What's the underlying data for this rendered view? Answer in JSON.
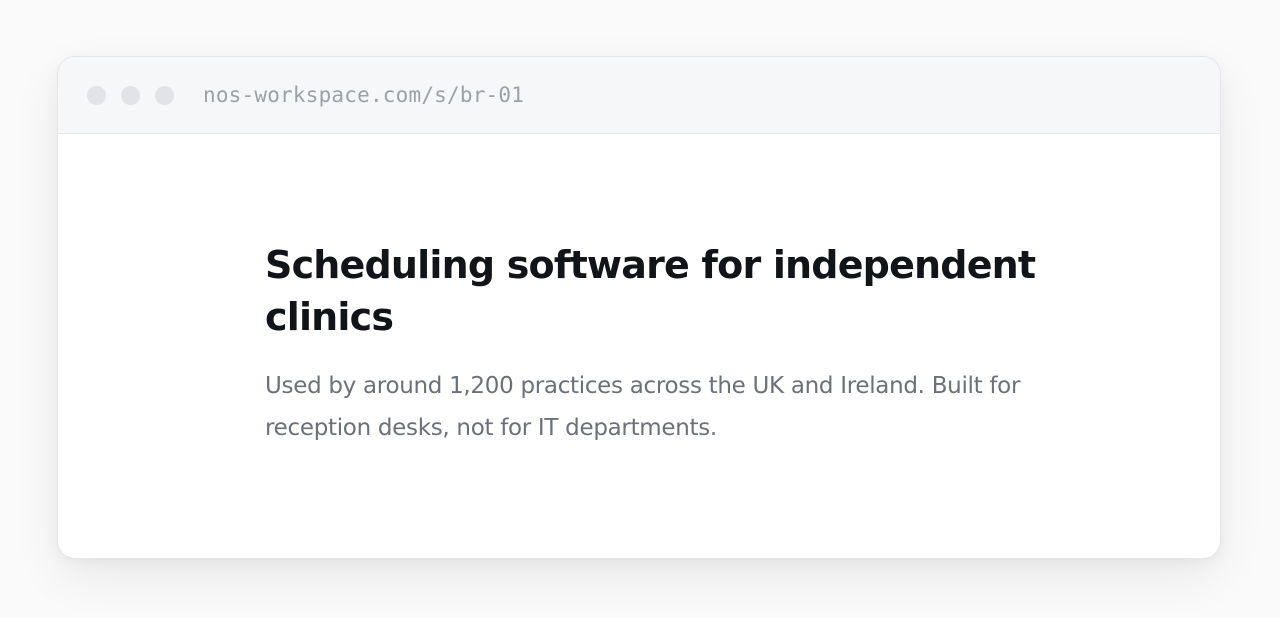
{
  "browser": {
    "url": "nos-workspace.com/s/br-01",
    "window_controls": [
      "close-dot",
      "minimize-dot",
      "maximize-dot"
    ]
  },
  "hero": {
    "headline": "Scheduling software for independent clinics",
    "subtext": "Used by around 1,200 practices across the UK and Ireland. Built for reception desks, not for IT departments."
  },
  "colors": {
    "headline": "#111418",
    "subtext": "#6b7079",
    "url": "#9ca1a8",
    "titlebar": "#f6f7f9",
    "window_dot": "#e1e3e6"
  }
}
